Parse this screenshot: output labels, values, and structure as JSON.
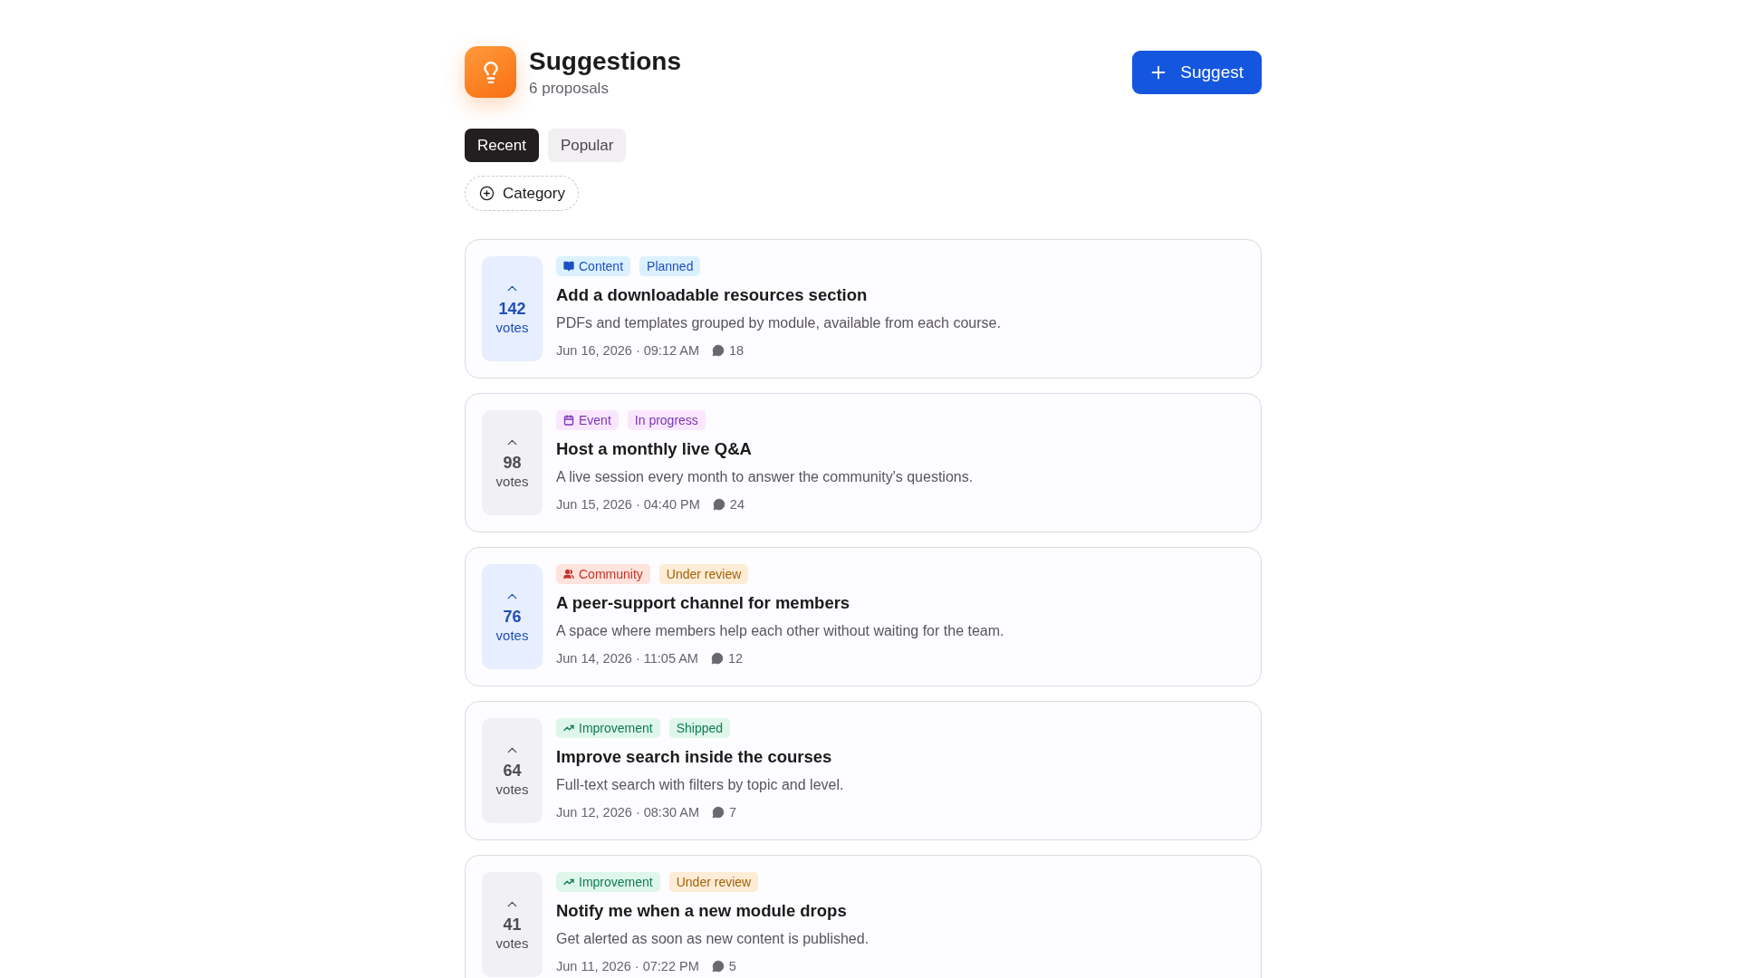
{
  "header": {
    "title": "Suggestions",
    "subtitle": "6 proposals",
    "action": "Suggest"
  },
  "tabs": [
    {
      "label": "Recent",
      "selected": true
    },
    {
      "label": "Popular",
      "selected": false
    }
  ],
  "filter": {
    "label": "Category"
  },
  "suggestions": [
    {
      "voted": true,
      "votes": "142",
      "votes_label": "votes",
      "category": {
        "kind": "content",
        "label": "Content",
        "color": "#1d4fc4"
      },
      "status": {
        "label": "Planned",
        "color": "#1d4fc4"
      },
      "title": "Add a downloadable resources section",
      "description": "PDFs and templates grouped by module, available from each course.",
      "date": "Jun 16, 2026 · 09:12 AM",
      "comments": "18"
    },
    {
      "voted": false,
      "votes": "98",
      "votes_label": "votes",
      "category": {
        "kind": "event",
        "label": "Event",
        "color": "#7b36b0"
      },
      "status": {
        "label": "In progress",
        "color": "#7b36b0"
      },
      "title": "Host a monthly live Q&A",
      "description": "A live session every month to answer the community's questions.",
      "date": "Jun 15, 2026 · 04:40 PM",
      "comments": "24"
    },
    {
      "voted": true,
      "votes": "76",
      "votes_label": "votes",
      "category": {
        "kind": "community",
        "label": "Community",
        "color": "#c2352b"
      },
      "status": {
        "label": "Under review",
        "color": "#a16207"
      },
      "title": "A peer-support channel for members",
      "description": "A space where members help each other without waiting for the team.",
      "date": "Jun 14, 2026 · 11:05 AM",
      "comments": "12"
    },
    {
      "voted": false,
      "votes": "64",
      "votes_label": "votes",
      "category": {
        "kind": "improvement",
        "label": "Improvement",
        "color": "#0f7a55"
      },
      "status": {
        "label": "Shipped",
        "color": "#0f7a55"
      },
      "title": "Improve search inside the courses",
      "description": "Full-text search with filters by topic and level.",
      "date": "Jun 12, 2026 · 08:30 AM",
      "comments": "7"
    },
    {
      "voted": false,
      "votes": "41",
      "votes_label": "votes",
      "category": {
        "kind": "improvement",
        "label": "Improvement",
        "color": "#0f7a55"
      },
      "status": {
        "label": "Under review",
        "color": "#a16207"
      },
      "title": "Notify me when a new module drops",
      "description": "Get alerted as soon as new content is published.",
      "date": "Jun 11, 2026 · 07:22 PM",
      "comments": "5"
    }
  ]
}
